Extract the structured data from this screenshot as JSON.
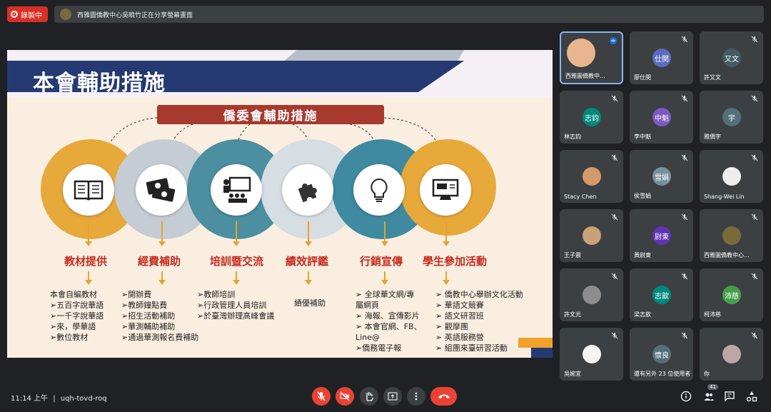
{
  "recording": {
    "label": "錄製中"
  },
  "banner": {
    "text": "西雅圖僑教中心吳曉竹正在分享螢幕畫面"
  },
  "slide": {
    "title": "本會輔助措施",
    "ribbon": "僑委會輔助措施",
    "categories": [
      {
        "label": "教材提供",
        "items": [
          "本會自編教材",
          "➢五百字說華語",
          "➢一千字說華語",
          "➢來，學華語",
          "➢數位教材"
        ]
      },
      {
        "label": "經費補助",
        "items": [
          "➢開辦費",
          "➢教師鐘點費",
          "➢招生活動補助",
          "➢華測輔助補助",
          "➢通過華測報名費補助"
        ]
      },
      {
        "label": "培訓暨交流",
        "items": [
          "➢教師培訓",
          "➢行政管理人員培訓",
          "➢於臺灣辦理高峰會議"
        ]
      },
      {
        "label": "績效評鑑",
        "items": [
          "績優補助"
        ]
      },
      {
        "label": "行銷宣傳",
        "items": [
          "➢ 全球華文網/專",
          "   屬網頁",
          "➢ 海報、宣傳影片",
          "➢ 本會官網、FB、",
          "   Line@",
          "➢僑務電子報"
        ]
      },
      {
        "label": "學生參加活動",
        "items": [
          "➢ 僑教中心舉辦文化活動",
          "➢ 華語文競賽",
          "➢ 語文研習班",
          "➢ 觀摩團",
          "➢ 英語服務營",
          "➢ 組團來臺研習活動"
        ]
      }
    ]
  },
  "participants": [
    {
      "name": "西雅圖僑教中...",
      "initials": "",
      "color": "#e8b58e",
      "active": true
    },
    {
      "name": "廖仕閔",
      "initials": "仕閔",
      "color": "#5c6bc0"
    },
    {
      "name": "許又文",
      "initials": "又文",
      "color": "#455a64"
    },
    {
      "name": "林志鈞",
      "initials": "志鈞",
      "color": "#00897b"
    },
    {
      "name": "李中魁",
      "initials": "中魁",
      "color": "#7e57c2"
    },
    {
      "name": "雅僑宇",
      "initials": "宇",
      "color": "#546e7a"
    },
    {
      "name": "Stacy Chen",
      "initials": "",
      "color": "#d39a6a"
    },
    {
      "name": "侯雪娟",
      "initials": "雪娟",
      "color": "#78909c"
    },
    {
      "name": "Shang-Wei Lin",
      "initials": "",
      "color": "#eeeeee"
    },
    {
      "name": "王子震",
      "initials": "",
      "color": "#c9a27a"
    },
    {
      "name": "黃尉東",
      "initials": "尉東",
      "color": "#5e35b1"
    },
    {
      "name": "西雅圖僑教中心...",
      "initials": "",
      "color": "#7a6a3a"
    },
    {
      "name": "許文光",
      "initials": "",
      "color": "#8d8d8d"
    },
    {
      "name": "梁志歆",
      "initials": "志歆",
      "color": "#00897b"
    },
    {
      "name": "柯沛慈",
      "initials": "沛慈",
      "color": "#43a047"
    },
    {
      "name": "吳婉宜",
      "initials": "",
      "color": "#f5f5f5"
    },
    {
      "name": "還有另外 23 位使用者",
      "initials": "懷良",
      "color": "#546e7a"
    },
    {
      "name": "你",
      "initials": "",
      "color": "#bfa6a6"
    }
  ],
  "footer": {
    "time": "11:14 上午",
    "separator": "|",
    "meeting_code": "uqh-tovd-roq",
    "participant_count": "41"
  },
  "colors": {
    "accent_red": "#ea4335",
    "tile_bg": "#3c4043",
    "slide_navy": "#253a73",
    "slide_red": "#c62b1e"
  }
}
